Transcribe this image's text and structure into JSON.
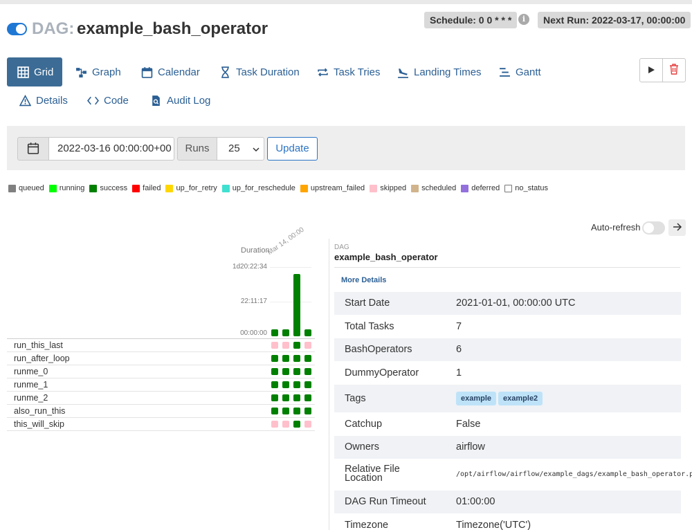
{
  "header": {
    "dag_prefix": "DAG:",
    "dag_id": "example_bash_operator",
    "schedule": "Schedule: 0 0 * * *",
    "next_run": "Next Run: 2022-03-17, 00:00:00",
    "info_glyph": "i"
  },
  "tabs": [
    {
      "label": "Grid",
      "icon": "grid-icon"
    },
    {
      "label": "Graph",
      "icon": "graph-icon"
    },
    {
      "label": "Calendar",
      "icon": "calendar-icon"
    },
    {
      "label": "Task Duration",
      "icon": "hourglass-icon"
    },
    {
      "label": "Task Tries",
      "icon": "retry-icon"
    },
    {
      "label": "Landing Times",
      "icon": "plane-landing-icon"
    },
    {
      "label": "Gantt",
      "icon": "gantt-icon"
    },
    {
      "label": "Details",
      "icon": "warning-triangle-icon"
    },
    {
      "label": "Code",
      "icon": "code-icon"
    },
    {
      "label": "Audit Log",
      "icon": "file-search-icon"
    }
  ],
  "actions": {
    "trigger_icon": "play-icon",
    "delete_icon": "trash-icon"
  },
  "filters": {
    "base_date": "2022-03-16 00:00:00+00",
    "runs_label": "Runs",
    "runs_value": "25",
    "update_label": "Update"
  },
  "legend": [
    {
      "label": "queued",
      "color": "#808080"
    },
    {
      "label": "running",
      "color": "#00ff00"
    },
    {
      "label": "success",
      "color": "#008000"
    },
    {
      "label": "failed",
      "color": "#ff0000"
    },
    {
      "label": "up_for_retry",
      "color": "#ffd700"
    },
    {
      "label": "up_for_reschedule",
      "color": "#40e0d0"
    },
    {
      "label": "upstream_failed",
      "color": "#ffa500"
    },
    {
      "label": "skipped",
      "color": "#ffc0cb"
    },
    {
      "label": "scheduled",
      "color": "#d2b48c"
    },
    {
      "label": "deferred",
      "color": "#9370db"
    },
    {
      "label": "no_status",
      "color": "#ffffff"
    }
  ],
  "grid": {
    "autorefresh_label": "Auto-refresh",
    "duration_label": "Duration",
    "run_date_label": "Mar 14, 00:00",
    "y_ticks": [
      "1d20:22:34",
      "22:11:17",
      "00:00:00"
    ],
    "runs_durations_fraction": [
      0.08,
      0.08,
      0.9,
      0.08
    ],
    "tasks": [
      {
        "name": "run_this_last",
        "states": [
          "skipped",
          "skipped",
          "success",
          "skipped"
        ]
      },
      {
        "name": "run_after_loop",
        "states": [
          "success",
          "success",
          "success",
          "success"
        ]
      },
      {
        "name": "runme_0",
        "states": [
          "success",
          "success",
          "success",
          "success"
        ]
      },
      {
        "name": "runme_1",
        "states": [
          "success",
          "success",
          "success",
          "success"
        ]
      },
      {
        "name": "runme_2",
        "states": [
          "success",
          "success",
          "success",
          "success"
        ]
      },
      {
        "name": "also_run_this",
        "states": [
          "success",
          "success",
          "success",
          "success"
        ]
      },
      {
        "name": "this_will_skip",
        "states": [
          "skipped",
          "skipped",
          "success",
          "skipped"
        ]
      }
    ]
  },
  "details": {
    "kicker": "DAG",
    "title": "example_bash_operator",
    "more_details": "More Details",
    "rows": [
      {
        "key": "Start Date",
        "value": "2021-01-01, 00:00:00 UTC"
      },
      {
        "key": "Total Tasks",
        "value": "7"
      },
      {
        "key": "BashOperators",
        "value": "6"
      },
      {
        "key": "DummyOperator",
        "value": "1"
      },
      {
        "key": "Tags",
        "tags": [
          "example",
          "example2"
        ]
      },
      {
        "key": "Catchup",
        "value": "False"
      },
      {
        "key": "Owners",
        "value": "airflow"
      },
      {
        "key": "Relative File Location",
        "value": "/opt/airflow/airflow/example_dags/example_bash_operator.py",
        "mono": true
      },
      {
        "key": "DAG Run Timeout",
        "value": "01:00:00"
      },
      {
        "key": "Timezone",
        "value": "Timezone('UTC')"
      }
    ]
  }
}
